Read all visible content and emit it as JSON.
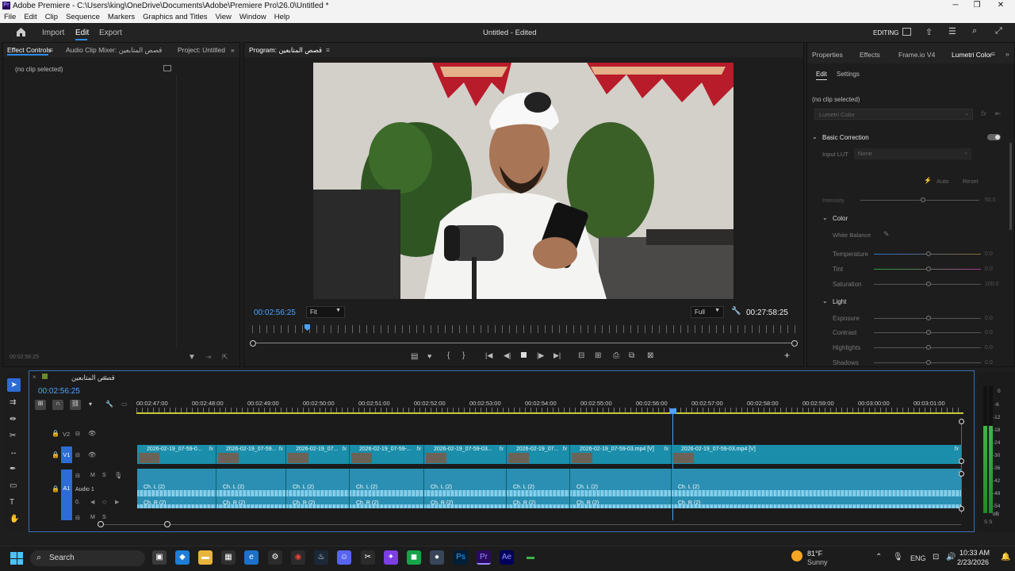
{
  "window": {
    "title": "Adobe Premiere - C:\\Users\\king\\OneDrive\\Documents\\Adobe\\Premiere Pro\\26.0\\Untitled *"
  },
  "menu": [
    "File",
    "Edit",
    "Clip",
    "Sequence",
    "Markers",
    "Graphics and Titles",
    "View",
    "Window",
    "Help"
  ],
  "header": {
    "import": "Import",
    "edit": "Edit",
    "export": "Export",
    "project_status": "Untitled - Edited",
    "workspace": "EDITING"
  },
  "left_panel": {
    "tabs": [
      "Effect Controls",
      "Audio Clip Mixer: قصص المتابعين",
      "Project: Untitled"
    ],
    "no_clip": "(no clip selected)",
    "timecode": "00:02:56:25"
  },
  "program": {
    "tab": "Program: قصص المتابعين",
    "timecode": "00:02:56:25",
    "fit": "Fit",
    "quality": "Full",
    "duration": "00:27:58:25"
  },
  "right_panel": {
    "tabs": [
      "Properties",
      "Effects",
      "Frame.io V4",
      "Lumetri Color"
    ],
    "subtabs": [
      "Edit",
      "Settings"
    ],
    "no_clip": "(no clip selected)",
    "dropdown": "Lumetri Color",
    "basic_correction": "Basic Correction",
    "input_lut_label": "Input LUT",
    "input_lut_value": "None",
    "auto": "Auto",
    "reset": "Reset",
    "intensity": {
      "label": "Intensity",
      "value": "50.0"
    },
    "color_section": "Color",
    "white_balance": "White Balance",
    "color_rows": [
      {
        "label": "Temperature",
        "value": "0.0"
      },
      {
        "label": "Tint",
        "value": "0.0"
      },
      {
        "label": "Saturation",
        "value": "100.0"
      }
    ],
    "light_section": "Light",
    "light_rows": [
      {
        "label": "Exposure",
        "value": "0.0"
      },
      {
        "label": "Contrast",
        "value": "0.0"
      },
      {
        "label": "Highlights",
        "value": "0.0"
      },
      {
        "label": "Shadows",
        "value": "0.0"
      }
    ]
  },
  "timeline": {
    "tab": "قصص المتابعين",
    "timecode": "00:02:56:25",
    "ruler": [
      "00:02:47:00",
      "00:02:48:00",
      "00:02:49:00",
      "00:02:50:00",
      "00:02:51:00",
      "00:02:52:00",
      "00:02:53:00",
      "00:02:54:00",
      "00:02:55:00",
      "00:02:56:00",
      "00:02:57:00",
      "00:02:58:00",
      "00:02:59:00",
      "00:03:00:00",
      "00:03:01:00"
    ],
    "tracks": {
      "v2": "V2",
      "v1": "V1",
      "a1": "A1",
      "audio1": "Audio 1",
      "a1_vol": "0.",
      "m": "M",
      "s": "S"
    },
    "video_clips": [
      "2026-02-19_07-59-0...",
      "2026-02-19_07-59...",
      "2026-02-19_07...",
      "2026-02-19_07-59-...",
      "2026-02-19_07-59-03...",
      "2026-02-19_07...",
      "2026-02-19_07-59-03.mp4 [V]",
      "2026-02-19_07-59-03.mp4 [V]"
    ],
    "audio_left": "Ch. L (2)",
    "audio_right": "Ch. R (2)",
    "meter_labels": [
      "0",
      "-6",
      "-12",
      "-18",
      "-24",
      "-30",
      "-36",
      "-42",
      "-48",
      "-54",
      "dB"
    ],
    "meter_solo": "S S"
  },
  "taskbar": {
    "search": "Search",
    "weather_temp": "81°F",
    "weather_desc": "Sunny",
    "lang": "ENG",
    "time": "10:33 AM",
    "date": "2/23/2026"
  }
}
